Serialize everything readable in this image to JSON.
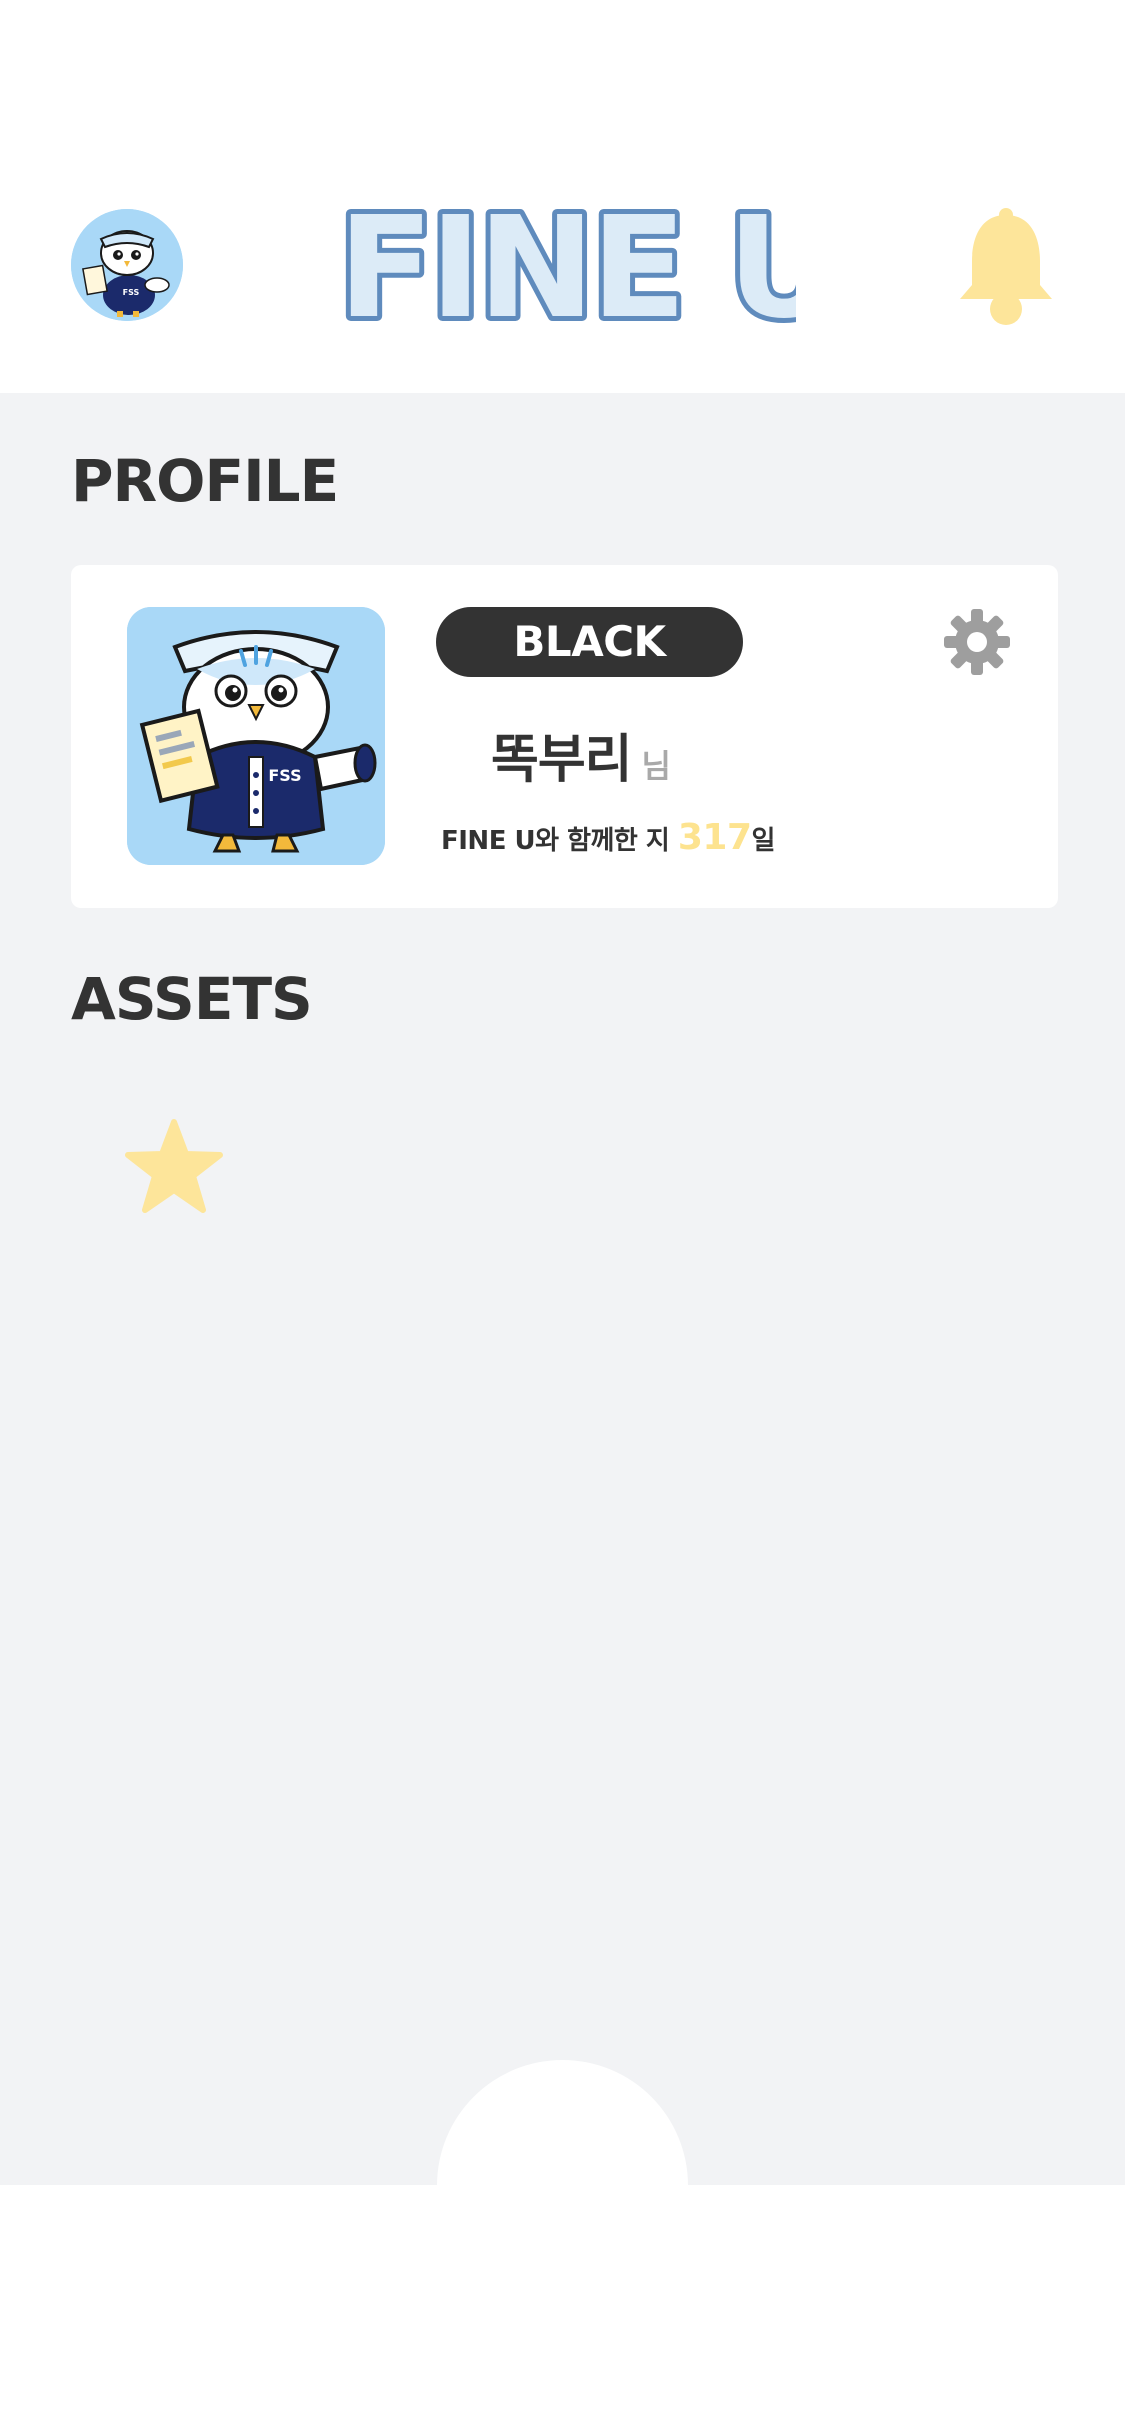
{
  "header": {
    "logo_text": "FINE U",
    "avatar_icon": "owl-mascot-icon",
    "notification_icon": "bell-icon",
    "colors": {
      "logo_fill": "#dcebf7",
      "logo_outline": "#5f8bbd",
      "logo_u_fill": "#f2dca0",
      "bell": "#fde59a"
    }
  },
  "profile": {
    "section_title": "PROFILE",
    "tier": "BLACK",
    "username": "똑부리",
    "honorific": "님",
    "days_prefix": "FINE U와 함께한 지 ",
    "days_count": "317",
    "days_suffix": "일",
    "avatar_icon": "owl-mascot-icon",
    "avatar_badge_text": "FSS",
    "settings_icon": "gear-icon",
    "colors": {
      "tier_bg": "#333333",
      "days_accent": "#fde38f",
      "avatar_bg": "#a9d8f7"
    }
  },
  "assets": {
    "section_title": "ASSETS",
    "star_icon": "star-icon",
    "star_color": "#fde59a"
  },
  "bottom_nav": {
    "home_button_icon": "home-bump"
  },
  "colors": {
    "page_bg": "#f2f3f5",
    "card_bg": "#ffffff",
    "text_primary": "#333333",
    "text_muted": "#a9a9a9"
  }
}
